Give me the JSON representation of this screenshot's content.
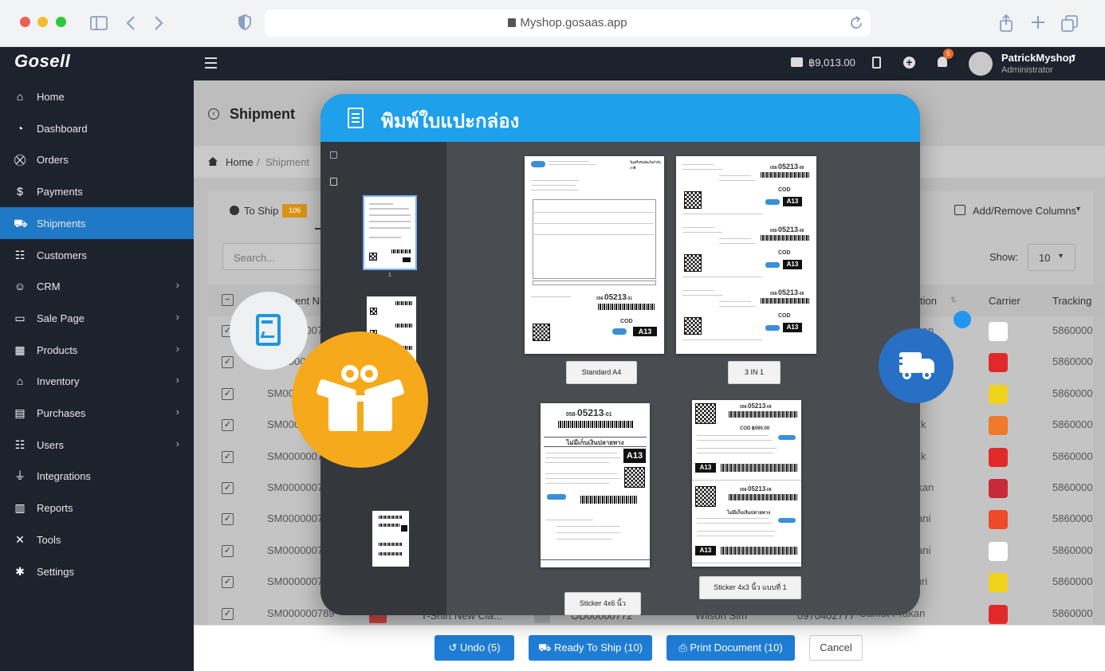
{
  "browser": {
    "url": "Myshop.gosaas.app"
  },
  "header": {
    "logo": "Gosell",
    "balance": "฿9,013.00",
    "notif_count": "5",
    "user_name": "PatrickMyshop",
    "user_role": "Administrator"
  },
  "sidebar": {
    "items": [
      {
        "label": "Home",
        "icon": "home-icon"
      },
      {
        "label": "Dashboard",
        "icon": "dashboard-icon"
      },
      {
        "label": "Orders",
        "icon": "cart-icon"
      },
      {
        "label": "Payments",
        "icon": "money-bag-icon"
      },
      {
        "label": "Shipments",
        "icon": "truck-icon"
      },
      {
        "label": "Customers",
        "icon": "users-icon"
      },
      {
        "label": "CRM",
        "icon": "crm-icon"
      },
      {
        "label": "Sale Page",
        "icon": "browser-icon"
      },
      {
        "label": "Products",
        "icon": "boxes-icon"
      },
      {
        "label": "Inventory",
        "icon": "warehouse-icon"
      },
      {
        "label": "Purchases",
        "icon": "purchase-icon"
      },
      {
        "label": "Users",
        "icon": "user-group-icon"
      },
      {
        "label": "Integrations",
        "icon": "plug-icon"
      },
      {
        "label": "Reports",
        "icon": "chart-icon"
      },
      {
        "label": "Tools",
        "icon": "tools-icon"
      },
      {
        "label": "Settings",
        "icon": "gear-icon"
      }
    ]
  },
  "page": {
    "title": "Shipment",
    "breadcrumb": {
      "home": "Home",
      "current": "Shipment"
    },
    "tab_to_ship": "To Ship",
    "tab_to_ship_count": "106",
    "add_remove_columns": "Add/Remove Columns",
    "search_placeholder": "Search...",
    "show_label": "Show:",
    "show_value": "10",
    "columns": {
      "shipment_no": "ent No",
      "location": "tion",
      "carrier": "Carrier",
      "tracking": "Tracking"
    },
    "rows": [
      {
        "no": "SM0000007",
        "loc": "Prakan",
        "tracking": "5860000",
        "carrier_color": "#ffffff"
      },
      {
        "no": "SM0000007",
        "loc": "",
        "tracking": "5860000",
        "carrier_color": "#e02a2a"
      },
      {
        "no": "SM00",
        "loc": "an",
        "tracking": "5860000",
        "carrier_color": "#f0d21c"
      },
      {
        "no": "SM000",
        "loc": "k",
        "tracking": "5860000",
        "carrier_color": "#f07a2a"
      },
      {
        "no": "SM0000007",
        "loc": "k",
        "tracking": "5860000",
        "carrier_color": "#e02a2a"
      },
      {
        "no": "SM0000007",
        "loc": "Prakan",
        "tracking": "5860000",
        "carrier_color": "#c82a3a"
      },
      {
        "no": "SM0000007",
        "loc": "Thani",
        "tracking": "5860000",
        "carrier_color": "#ee4a2a"
      },
      {
        "no": "SM0000007",
        "loc": "Thani",
        "tracking": "5860000",
        "carrier_color": "#ffffff"
      },
      {
        "no": "SM0000007",
        "loc": "Buri",
        "tracking": "5860000",
        "carrier_color": "#f0d21c"
      },
      {
        "no": "SM000000789",
        "loc": "Samut Prakan",
        "tracking": "5860000",
        "carrier_color": "#e02a2a"
      }
    ],
    "last_row_extra": {
      "product": "T-Shirt New Cla...",
      "order": "OD00000772",
      "customer": "Wilson Sim",
      "phone": "0970402777"
    }
  },
  "actions": {
    "undo": "Undo (5)",
    "ready": "Ready To Ship (10)",
    "print": "Print Document (10)",
    "cancel": "Cancel"
  },
  "modal": {
    "title": "พิมพ์ใบแปะกล่อง",
    "page_number": "1",
    "templates": [
      {
        "label": "Standard A4"
      },
      {
        "label": "3 IN 1"
      },
      {
        "label": "Sticker 4x6 นิ้ว"
      },
      {
        "label": "Sticker 4x3 นิ้ว แบบที่ 1"
      }
    ],
    "label_texts": {
      "code": "05213",
      "prefix": "058-",
      "suffix_a4": "-01",
      "suffix_3in1": "-08",
      "cod": "COD",
      "sort_code": "A13",
      "cod_amount": "COD ฿590.00",
      "no_cod_note": "ไม่มีเก็บเงินปลายทาง",
      "doc_title": "ใบเสร็จรับเงิน/ใบกำกับภาษี"
    }
  },
  "colors": {
    "sidebar_bg": "#1d232d",
    "active_blue": "#1f79c6",
    "modal_header": "#1ea0ea",
    "accent_orange": "#f6a91b",
    "truck_circle": "#2870c6"
  }
}
